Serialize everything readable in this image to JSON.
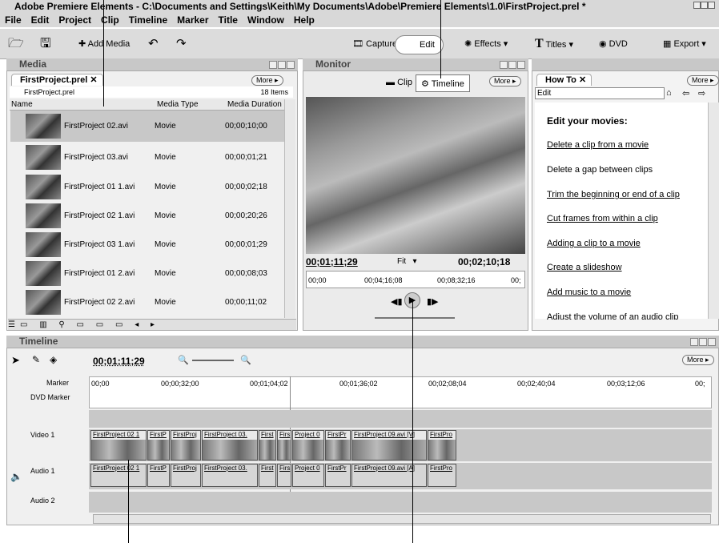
{
  "window_title": "Adobe Premiere Elements - C:\\Documents and Settings\\Keith\\My Documents\\Adobe\\Premiere Elements\\1.0\\FirstProject.prel *",
  "menu": [
    "File",
    "Edit",
    "Project",
    "Clip",
    "Timeline",
    "Marker",
    "Title",
    "Window",
    "Help"
  ],
  "toolbar": {
    "add_media": "Add Media",
    "capture": "Capture",
    "edit": "Edit",
    "effects": "Effects",
    "titles": "Titles",
    "dvd": "DVD",
    "export": "Export"
  },
  "media": {
    "title": "Media",
    "tab": "FirstProject.prel",
    "more": "More",
    "project": "FirstProject.prel",
    "items_count": "18 Items",
    "columns": [
      "Name",
      "Media Type",
      "Media Duration"
    ],
    "rows": [
      {
        "name": "FirstProject 02.avi",
        "type": "Movie",
        "dur": "00;00;10;00"
      },
      {
        "name": "FirstProject 03.avi",
        "type": "Movie",
        "dur": "00;00;01;21"
      },
      {
        "name": "FirstProject 01 1.avi",
        "type": "Movie",
        "dur": "00;00;02;18"
      },
      {
        "name": "FirstProject 02 1.avi",
        "type": "Movie",
        "dur": "00;00;20;26"
      },
      {
        "name": "FirstProject 03 1.avi",
        "type": "Movie",
        "dur": "00;00;01;29"
      },
      {
        "name": "FirstProject 01 2.avi",
        "type": "Movie",
        "dur": "00;00;08;03"
      },
      {
        "name": "FirstProject 02 2.avi",
        "type": "Movie",
        "dur": "00;00;11;02"
      }
    ]
  },
  "monitor": {
    "title": "Monitor",
    "clip": "Clip",
    "timeline": "Timeline",
    "more": "More",
    "current": "00;01;11;29",
    "fit": "Fit",
    "duration": "00;02;10;18",
    "ruler": [
      "00;00",
      "00;04;16;08",
      "00;08;32;16",
      "00;"
    ]
  },
  "howto": {
    "tab": "How To",
    "more": "More",
    "search": "Edit",
    "heading": "Edit your movies:",
    "links": [
      "Delete a clip from a movie",
      "Delete a gap between clips",
      "Trim the beginning or end of a clip",
      "Cut frames from within a clip",
      "Adding a clip to a movie",
      "Create a slideshow",
      "Add music to a movie",
      "Adjust the volume of an audio clip"
    ]
  },
  "timeline": {
    "title": "Timeline",
    "more": "More",
    "time": "00;01;11;29",
    "marker": "Marker",
    "dvd_marker": "DVD Marker",
    "ruler": [
      "00;00",
      "00;00;32;00",
      "00;01;04;02",
      "00;01;36;02",
      "00;02;08;04",
      "00;02;40;04",
      "00;03;12;06",
      "00;"
    ],
    "video_track": "Video 1",
    "audio_track": "Audio 1",
    "audio2_track": "Audio 2",
    "video_clips": [
      "FirstProject 02 1",
      "FirstP",
      "FirstProj",
      "FirstProject 03.",
      "First",
      "Firs",
      "Project 0",
      "FirstPr",
      "FirstProject 09.avi [V]",
      "FirstPro"
    ],
    "audio_clips": [
      "FirstProject 02 1",
      "FirstP",
      "FirstProj",
      "FirstProject 03.",
      "First",
      "Firs",
      "Project 0",
      "FirstPr",
      "FirstProject 09.avi [A]",
      "FirstPro"
    ]
  }
}
